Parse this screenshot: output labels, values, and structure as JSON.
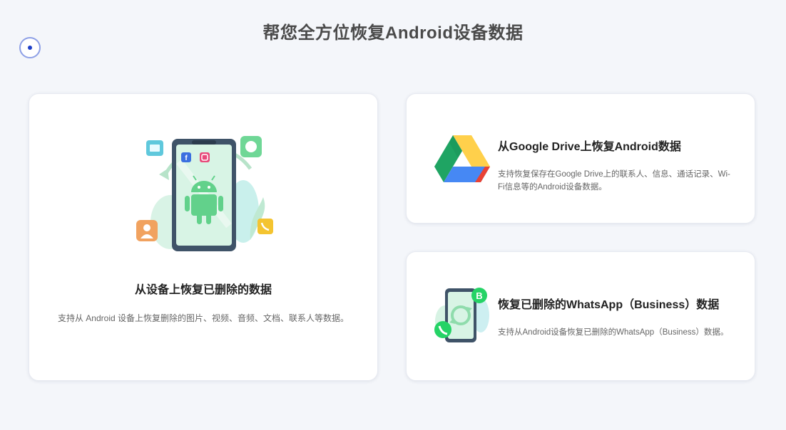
{
  "header": {
    "title": "帮您全方位恢复Android设备数据"
  },
  "cards": {
    "device": {
      "title": "从设备上恢复已删除的数据",
      "description": "支持从 Android 设备上恢复删除的图片、视频、音频、文档、联系人等数据。",
      "icon": "android-phone-icon"
    },
    "gdrive": {
      "title": "从Google Drive上恢复Android数据",
      "description": "支持恢复保存在Google Drive上的联系人、信息、通话记录、Wi-Fi信息等的Android设备数据。",
      "icon": "google-drive-icon"
    },
    "whatsapp": {
      "title": "恢复已删除的WhatsApp（Business）数据",
      "description": "支持从Android设备恢复已删除的WhatsApp（Business）数据。",
      "icon": "whatsapp-business-icon"
    }
  },
  "colors": {
    "accent": "#1d3fc8",
    "background": "#f4f6fa",
    "gdrive_green": "#1fa463",
    "gdrive_yellow": "#ffd04b",
    "gdrive_blue": "#4688f4",
    "gdrive_red": "#e94235",
    "whatsapp_green": "#25d366"
  }
}
